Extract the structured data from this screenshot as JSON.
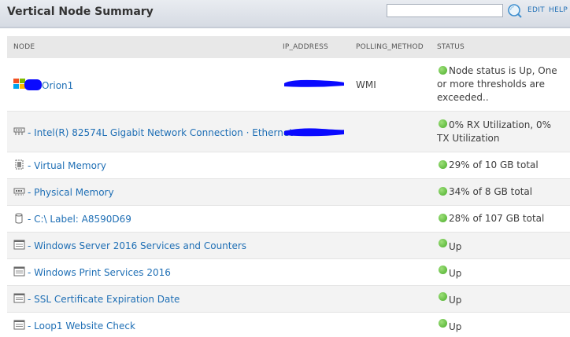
{
  "header": {
    "title": "Vertical Node Summary",
    "search_value": "",
    "edit_label": "EDIT",
    "help_label": "HELP"
  },
  "columns": [
    "NODE",
    "IP_ADDRESS",
    "POLLING_METHOD",
    "STATUS"
  ],
  "colors": {
    "link": "#1f6fb5",
    "status_up": "#4aad2a",
    "redaction": "#0a0aff"
  },
  "rows": [
    {
      "icon": "windows-logo-icon",
      "name": "Orion1",
      "ip_redacted": true,
      "polling": "WMI",
      "status": "Node status is Up, One or more thresholds are exceeded.."
    },
    {
      "icon": "network-interface-icon",
      "name": " - Intel(R) 82574L Gigabit Network Connection · Ethernet",
      "ip_redacted": true,
      "polling": "",
      "status": "0% RX Utilization, 0% TX Utilization"
    },
    {
      "icon": "virtual-memory-icon",
      "name": " - Virtual Memory",
      "polling": "",
      "status": "29% of 10 GB total"
    },
    {
      "icon": "physical-memory-icon",
      "name": " - Physical Memory",
      "polling": "",
      "status": "34% of 8 GB total"
    },
    {
      "icon": "disk-icon",
      "name": " - C:\\ Label: A8590D69",
      "polling": "",
      "status": "28% of 107 GB total"
    },
    {
      "icon": "application-icon",
      "name": " - Windows Server 2016 Services and Counters",
      "polling": "",
      "status": "Up"
    },
    {
      "icon": "application-icon",
      "name": " - Windows Print Services 2016",
      "polling": "",
      "status": "Up"
    },
    {
      "icon": "application-icon",
      "name": " - SSL Certificate Expiration Date",
      "polling": "",
      "status": "Up"
    },
    {
      "icon": "application-icon",
      "name": " - Loop1 Website Check",
      "polling": "",
      "status": "Up"
    }
  ]
}
